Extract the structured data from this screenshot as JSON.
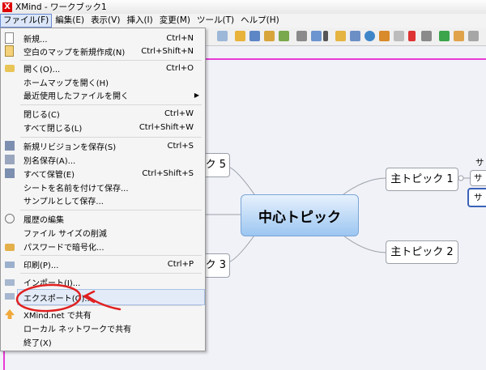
{
  "window": {
    "title": "XMind - ワークブック1",
    "app_icon": "X"
  },
  "menubar": [
    {
      "label": "ファイル(F)",
      "active": true
    },
    {
      "label": "編集(E)"
    },
    {
      "label": "表示(V)"
    },
    {
      "label": "挿入(I)"
    },
    {
      "label": "変更(M)"
    },
    {
      "label": "ツール(T)"
    },
    {
      "label": "ヘルプ(H)"
    }
  ],
  "file_menu": [
    {
      "label": "新規...",
      "shortcut": "Ctrl+N",
      "icon": "new-file-icon"
    },
    {
      "label": "空白のマップを新規作成(N)",
      "shortcut": "Ctrl+Shift+N",
      "icon": "blank-map-icon"
    },
    {
      "label": "開く(O)...",
      "shortcut": "Ctrl+O",
      "icon": "folder-open-icon"
    },
    {
      "label": "ホームマップを開く(H)",
      "shortcut": ""
    },
    {
      "label": "最近使用したファイルを開く",
      "shortcut": "",
      "submenu": "▶"
    },
    {
      "label": "閉じる(C)",
      "shortcut": "Ctrl+W"
    },
    {
      "label": "すべて閉じる(L)",
      "shortcut": "Ctrl+Shift+W"
    },
    {
      "label": "新規リビジョンを保存(S)",
      "shortcut": "Ctrl+S",
      "icon": "save-icon"
    },
    {
      "label": "別名保存(A)...",
      "shortcut": "",
      "icon": "save-as-icon"
    },
    {
      "label": "すべて保管(E)",
      "shortcut": "Ctrl+Shift+S",
      "icon": "save-all-icon"
    },
    {
      "label": "シートを名前を付けて保存...",
      "shortcut": ""
    },
    {
      "label": "サンプルとして保存...",
      "shortcut": ""
    },
    {
      "label": "履歴の編集",
      "shortcut": "",
      "icon": "history-icon"
    },
    {
      "label": "ファイル サイズの削減",
      "shortcut": ""
    },
    {
      "label": "パスワードで暗号化...",
      "shortcut": "",
      "icon": "lock-icon"
    },
    {
      "label": "印刷(P)...",
      "shortcut": "Ctrl+P",
      "icon": "print-icon"
    },
    {
      "label": "インポート(I)...",
      "shortcut": "",
      "icon": "import-icon"
    },
    {
      "label": "エクスポート(O)...",
      "shortcut": "",
      "icon": "export-icon",
      "highlighted": true
    },
    {
      "label": "XMind.net で共有",
      "shortcut": "",
      "icon": "share-up-icon"
    },
    {
      "label": "ローカル ネットワークで共有",
      "shortcut": ""
    },
    {
      "label": "終了(X)",
      "shortcut": ""
    }
  ],
  "mindmap": {
    "central": "中心トピック",
    "topic1": "主トピック 1",
    "topic2": "主トピック 2",
    "topic3_partial": "ク 3",
    "topic5_partial": "ク 5",
    "sub_partial_1": "サ",
    "sub_partial_2": "サ",
    "sub_partial_3": "サ"
  },
  "colors": {
    "accent_pink": "#e83ad6",
    "annotation_red": "#e02020",
    "highlight_blue": "#a9c1e6"
  }
}
